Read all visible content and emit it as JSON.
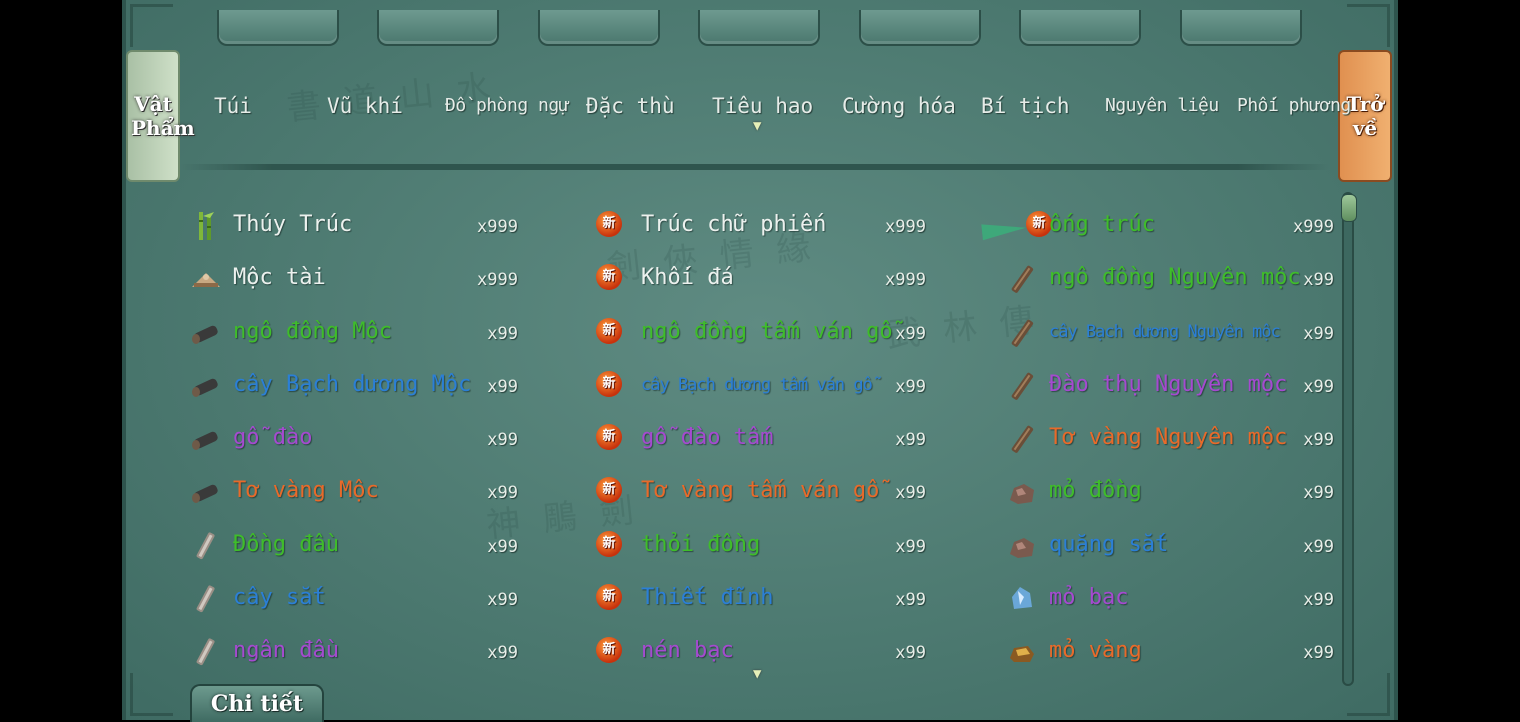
{
  "colors": {
    "green": "#3fbd2a",
    "blue": "#2b7fd6",
    "purple": "#a54ad0",
    "orange": "#e86a2a",
    "white": "#ecf1ee"
  },
  "side": {
    "left_label": "Vật Phẩm",
    "right_label": "Trở về"
  },
  "tabs": [
    "Túi",
    "Vũ khí",
    "Đồ phòng ngự",
    "Đặc thù",
    "Tiêu hao",
    "Cường hóa",
    "Bí tịch",
    "Nguyên liệu",
    "Phối phương"
  ],
  "active_tab_index": 4,
  "scroll_arrow": "chevron-down-icon",
  "new_badge_text": "新",
  "items": [
    {
      "name": "Thúy Trúc",
      "qty": "x999",
      "color": "white",
      "icon": "bamboo-icon"
    },
    {
      "name": "Mộc tài",
      "qty": "x999",
      "color": "white",
      "icon": "wood-pile-icon"
    },
    {
      "name": "ngô đồng Mộc",
      "qty": "x99",
      "color": "green",
      "icon": "log-icon"
    },
    {
      "name": "cây Bạch dương Mộc",
      "qty": "x99",
      "color": "blue",
      "icon": "log-icon"
    },
    {
      "name": "gỗ đào",
      "qty": "x99",
      "color": "purple",
      "icon": "log-icon"
    },
    {
      "name": "Tơ vàng Mộc",
      "qty": "x99",
      "color": "orange",
      "icon": "log-icon"
    },
    {
      "name": "Đồng đầu",
      "qty": "x99",
      "color": "green",
      "icon": "ingot-bar-icon"
    },
    {
      "name": "cây sắt",
      "qty": "x99",
      "color": "blue",
      "icon": "ingot-bar-icon"
    },
    {
      "name": "ngân đầu",
      "qty": "x99",
      "color": "purple",
      "icon": "ingot-bar-icon"
    },
    {
      "name": "Trúc chữ phiến",
      "qty": "x999",
      "color": "white",
      "icon": "new-badge-icon",
      "new": true
    },
    {
      "name": "Khối đá",
      "qty": "x999",
      "color": "white",
      "icon": "new-badge-icon",
      "new": true
    },
    {
      "name": "ngô đồng tấm ván gỗ",
      "qty": "x99",
      "color": "green",
      "icon": "new-badge-icon",
      "new": true
    },
    {
      "name": "cây Bạch dương tấm ván gỗ",
      "qty": "x99",
      "color": "blue",
      "icon": "new-badge-icon",
      "new": true,
      "small": true
    },
    {
      "name": "gỗ đào tấm",
      "qty": "x99",
      "color": "purple",
      "icon": "new-badge-icon",
      "new": true
    },
    {
      "name": "Tơ vàng tấm ván gỗ",
      "qty": "x99",
      "color": "orange",
      "icon": "new-badge-icon",
      "new": true
    },
    {
      "name": "thỏi đồng",
      "qty": "x99",
      "color": "green",
      "icon": "new-badge-icon",
      "new": true
    },
    {
      "name": "Thiết đĩnh",
      "qty": "x99",
      "color": "blue",
      "icon": "new-badge-icon",
      "new": true
    },
    {
      "name": "nén bạc",
      "qty": "x99",
      "color": "purple",
      "icon": "new-badge-icon",
      "new": true
    },
    {
      "name": "ống trúc",
      "qty": "x999",
      "color": "green",
      "icon": "new-badge-icon",
      "new": true
    },
    {
      "name": "ngô đồng Nguyên mộc",
      "qty": "x99",
      "color": "green",
      "icon": "plank-icon"
    },
    {
      "name": "cây Bạch dương Nguyên mộc",
      "qty": "x99",
      "color": "blue",
      "icon": "plank-icon",
      "small": true
    },
    {
      "name": "Đào thụ Nguyên mộc",
      "qty": "x99",
      "color": "purple",
      "icon": "plank-icon"
    },
    {
      "name": "Tơ vàng Nguyên mộc",
      "qty": "x99",
      "color": "orange",
      "icon": "plank-icon"
    },
    {
      "name": "mỏ đồng",
      "qty": "x99",
      "color": "green",
      "icon": "ore-icon"
    },
    {
      "name": "quặng sắt",
      "qty": "x99",
      "color": "blue",
      "icon": "ore-icon"
    },
    {
      "name": "mỏ bạc",
      "qty": "x99",
      "color": "purple",
      "icon": "crystal-ore-icon"
    },
    {
      "name": "mỏ vàng",
      "qty": "x99",
      "color": "orange",
      "icon": "gold-ore-icon"
    }
  ],
  "detail_button": "Chi tiết"
}
